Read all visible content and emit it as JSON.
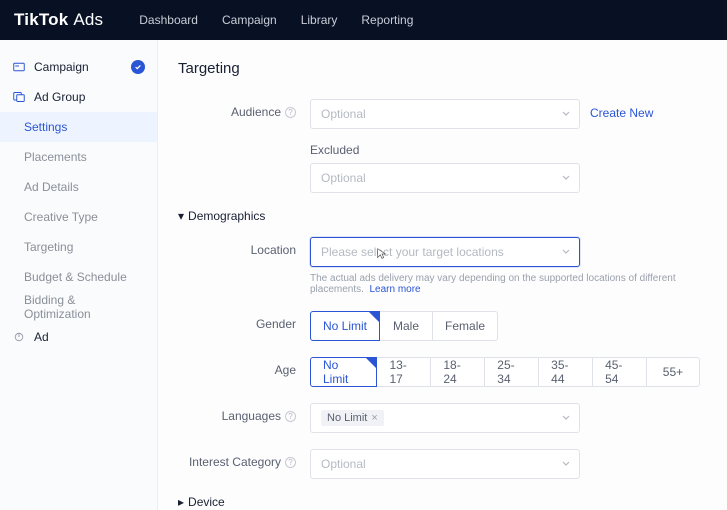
{
  "brand": {
    "bold": "TikTok",
    "light": "Ads"
  },
  "topnav": [
    "Dashboard",
    "Campaign",
    "Library",
    "Reporting"
  ],
  "side": {
    "campaign": "Campaign",
    "adGroup": "Ad Group",
    "steps": [
      "Settings",
      "Placements",
      "Ad Details",
      "Creative Type",
      "Targeting",
      "Budget & Schedule",
      "Bidding & Optimization"
    ],
    "ad": "Ad"
  },
  "page": {
    "title": "Targeting"
  },
  "labels": {
    "audience": "Audience",
    "excluded": "Excluded",
    "location": "Location",
    "gender": "Gender",
    "age": "Age",
    "languages": "Languages",
    "interest": "Interest Category"
  },
  "sections": {
    "demographics": "Demographics",
    "device": "Device"
  },
  "placeholders": {
    "optional": "Optional",
    "location": "Please select your target locations"
  },
  "links": {
    "createNew": "Create New",
    "learnMore": "Learn more"
  },
  "hints": {
    "location": "The actual ads delivery may vary depending on the supported locations of different placements."
  },
  "gender": {
    "options": [
      "No Limit",
      "Male",
      "Female"
    ],
    "selected": "No Limit"
  },
  "age": {
    "options": [
      "No Limit",
      "13-17",
      "18-24",
      "25-34",
      "35-44",
      "45-54",
      "55+"
    ],
    "selected": "No Limit"
  },
  "tags": {
    "noLimit": "No Limit"
  }
}
